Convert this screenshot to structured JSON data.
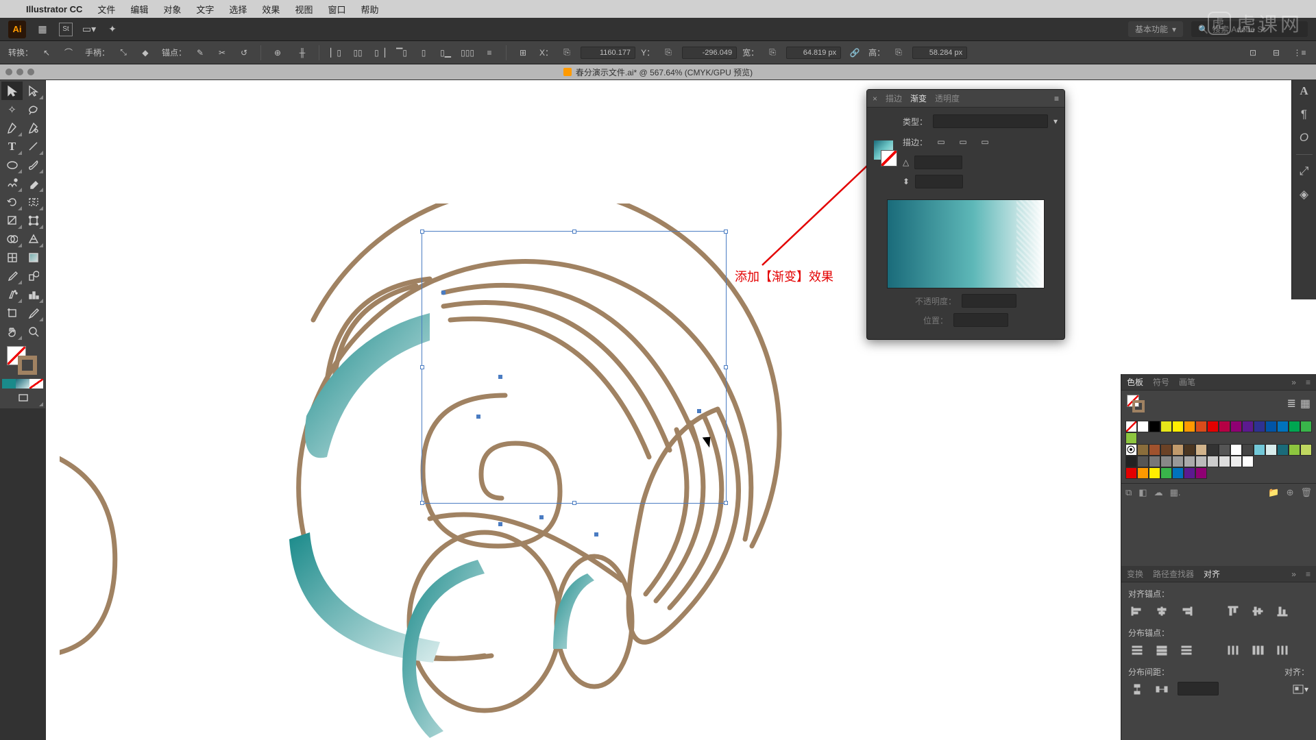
{
  "menubar": {
    "app": "Illustrator CC",
    "items": [
      "文件",
      "编辑",
      "对象",
      "文字",
      "选择",
      "效果",
      "视图",
      "窗口",
      "帮助"
    ]
  },
  "appbar": {
    "workspace_label": "基本功能",
    "search_placeholder": "搜索 Adobe St"
  },
  "controlbar": {
    "transform_label": "转换：",
    "handle_label": "手柄：",
    "anchor_label": "锚点：",
    "x_label": "X：",
    "x_value": "1160.177",
    "y_label": "Y：",
    "y_value": "-296.049",
    "w_label": "宽：",
    "w_value": "64.819 px",
    "h_label": "高：",
    "h_value": "58.284 px"
  },
  "document": {
    "tab_title": "春分演示文件.ai* @ 567.64% (CMYK/GPU 预览)"
  },
  "gradient_panel": {
    "tabs": [
      "描边",
      "渐变",
      "透明度"
    ],
    "active_tab": 1,
    "type_label": "类型：",
    "stroke_label": "描边：",
    "opacity_label": "不透明度：",
    "location_label": "位置："
  },
  "annotation_text": "添加【渐变】效果",
  "swatches_panel": {
    "tabs": [
      "色板",
      "符号",
      "画笔"
    ],
    "active_tab": 0,
    "colors_row1": [
      "none",
      "#ffffff",
      "#000000",
      "#e6e61a",
      "#ffee00",
      "#ff9900",
      "#d94c1a",
      "#e30000",
      "#b50044",
      "#8f0073",
      "#5c1a8f",
      "#2e3192",
      "#0054a6",
      "#0072bc",
      "#00a651",
      "#39b54a",
      "#8dc63f"
    ],
    "colors_row2": [
      "reg",
      "#8a6d3b",
      "#a0522d",
      "#6b4226",
      "#c19a6b",
      "#4b3621",
      "#d2b48c",
      "#333333",
      "#555555",
      "#ffffff",
      "#444444",
      "#72c8d8",
      "#d8ecec",
      "#1a6b7a",
      "#8dc63f",
      "#c0d860"
    ],
    "colors_row3": [
      "#222222",
      "#555555",
      "#777777",
      "#888888",
      "#999999",
      "#aaaaaa",
      "#bbbbbb",
      "#cccccc",
      "#dddddd",
      "#eeeeee",
      "#ffffff"
    ],
    "colors_row4": [
      "#e30000",
      "#ff9900",
      "#ffee00",
      "#39b54a",
      "#0072bc",
      "#5c1a8f",
      "#8f0073"
    ]
  },
  "align_panel": {
    "tabs": [
      "变换",
      "路径查找器",
      "对齐"
    ],
    "active_tab": 2,
    "align_anchor_label": "对齐锚点：",
    "distribute_anchor_label": "分布锚点：",
    "distribute_spacing_label": "分布间距：",
    "align_to_label": "对齐："
  },
  "watermark": "虎课网",
  "miniswatches": [
    "#1a8a8a",
    "linear-gradient(135deg,#1a6b7a,#d8ecec)",
    "nofill"
  ]
}
